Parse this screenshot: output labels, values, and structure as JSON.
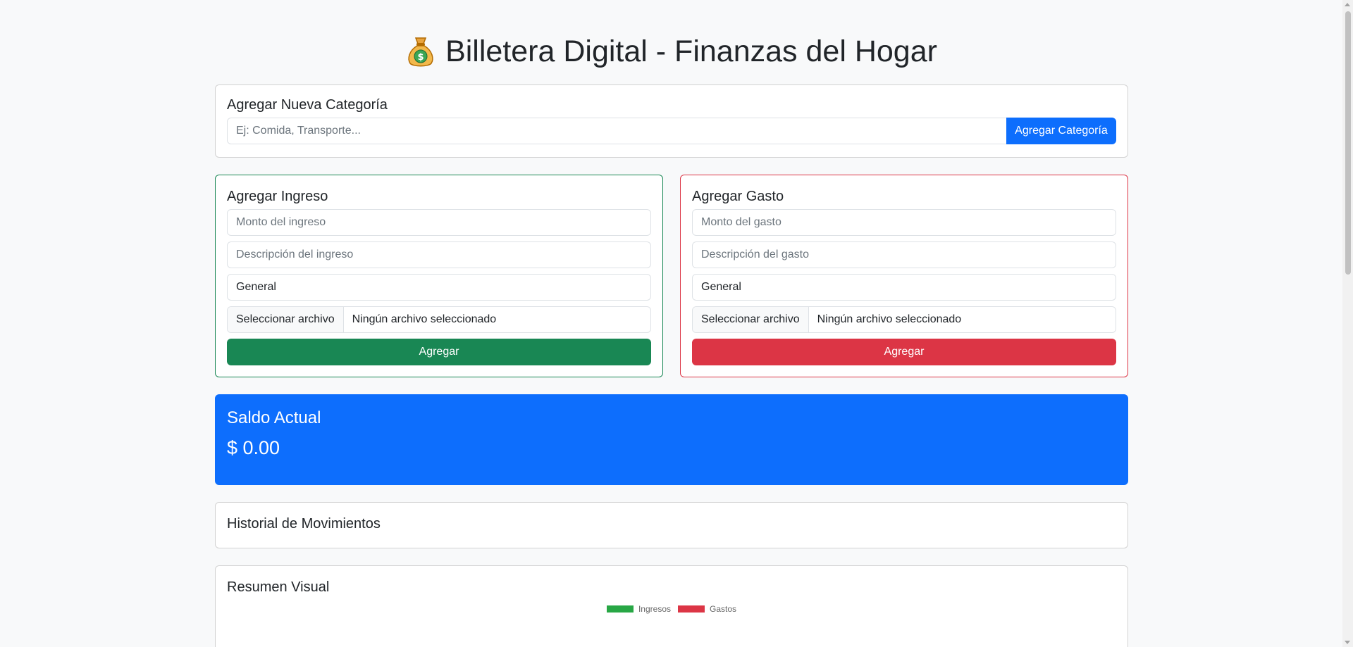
{
  "header": {
    "title": "Billetera Digital - Finanzas del Hogar",
    "icon": "money-bag-icon"
  },
  "category_card": {
    "title": "Agregar Nueva Categoría",
    "placeholder": "Ej: Comida, Transporte...",
    "button_label": "Agregar Categoría"
  },
  "income_card": {
    "title": "Agregar Ingreso",
    "amount_placeholder": "Monto del ingreso",
    "description_placeholder": "Descripción del ingreso",
    "category_selected": "General",
    "file_button": "Seleccionar archivo",
    "file_status": "Ningún archivo seleccionado",
    "submit_label": "Agregar"
  },
  "expense_card": {
    "title": "Agregar Gasto",
    "amount_placeholder": "Monto del gasto",
    "description_placeholder": "Descripción del gasto",
    "category_selected": "General",
    "file_button": "Seleccionar archivo",
    "file_status": "Ningún archivo seleccionado",
    "submit_label": "Agregar"
  },
  "balance_card": {
    "title": "Saldo Actual",
    "amount": "$ 0.00"
  },
  "history_card": {
    "title": "Historial de Movimientos"
  },
  "summary_card": {
    "title": "Resumen Visual",
    "legend": [
      {
        "label": "Ingresos",
        "color": "#28a745"
      },
      {
        "label": "Gastos",
        "color": "#dc3545"
      }
    ]
  },
  "colors": {
    "primary": "#0d6efd",
    "success": "#198754",
    "danger": "#dc3545"
  }
}
